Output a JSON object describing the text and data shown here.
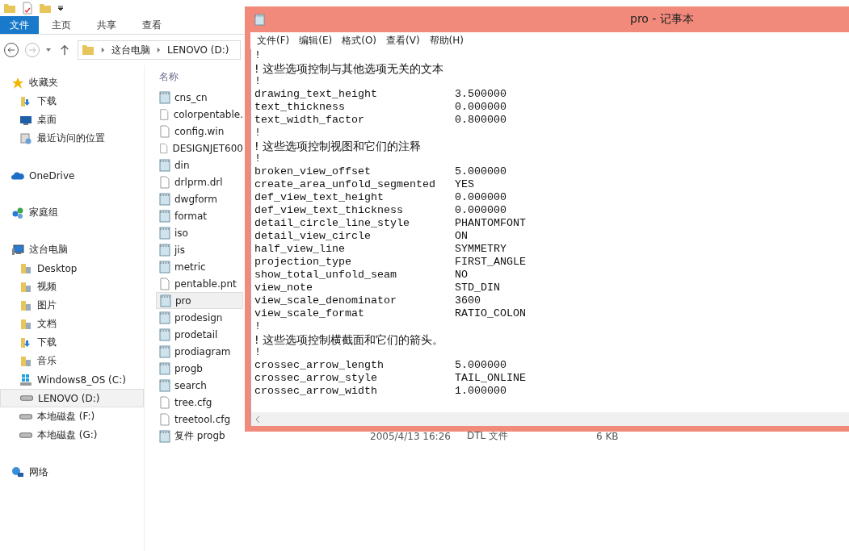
{
  "explorer": {
    "ribbon_tabs": [
      {
        "label": "文件",
        "selected": true
      },
      {
        "label": "主页",
        "selected": false
      },
      {
        "label": "共享",
        "selected": false
      },
      {
        "label": "查看",
        "selected": false
      }
    ],
    "address": {
      "crumbs": [
        "这台电脑",
        "LENOVO (D:)"
      ]
    },
    "nav": [
      {
        "label": "收藏夹",
        "kind": "favorites",
        "selected": false,
        "children": [
          {
            "label": "下载",
            "kind": "downloads",
            "selected": false
          },
          {
            "label": "桌面",
            "kind": "desktop",
            "selected": false
          },
          {
            "label": "最近访问的位置",
            "kind": "recent",
            "selected": false
          }
        ]
      },
      {
        "label": "OneDrive",
        "kind": "onedrive",
        "selected": false
      },
      {
        "label": "家庭组",
        "kind": "homegroup",
        "selected": false
      },
      {
        "label": "这台电脑",
        "kind": "pc",
        "selected": false,
        "children": [
          {
            "label": "Desktop",
            "kind": "folder",
            "selected": false
          },
          {
            "label": "视频",
            "kind": "folder",
            "selected": false
          },
          {
            "label": "图片",
            "kind": "folder",
            "selected": false
          },
          {
            "label": "文档",
            "kind": "folder",
            "selected": false
          },
          {
            "label": "下载",
            "kind": "downloads",
            "selected": false
          },
          {
            "label": "音乐",
            "kind": "folder",
            "selected": false
          },
          {
            "label": "Windows8_OS (C:)",
            "kind": "system-drive",
            "selected": false
          },
          {
            "label": "LENOVO (D:)",
            "kind": "drive",
            "selected": true
          },
          {
            "label": "本地磁盘 (F:)",
            "kind": "drive",
            "selected": false
          },
          {
            "label": "本地磁盘 (G:)",
            "kind": "drive",
            "selected": false
          }
        ]
      },
      {
        "label": "网络",
        "kind": "network",
        "selected": false
      }
    ],
    "name_header": "名称",
    "files": [
      {
        "name": "cns_cn",
        "kind": "document",
        "selected": false
      },
      {
        "name": "colorpentable.",
        "kind": "blank",
        "selected": false
      },
      {
        "name": "config.win",
        "kind": "blank",
        "selected": false
      },
      {
        "name": "DESIGNJET600",
        "kind": "blank",
        "selected": false
      },
      {
        "name": "din",
        "kind": "document",
        "selected": false
      },
      {
        "name": "drlprm.drl",
        "kind": "blank",
        "selected": false
      },
      {
        "name": "dwgform",
        "kind": "document",
        "selected": false
      },
      {
        "name": "format",
        "kind": "document",
        "selected": false
      },
      {
        "name": "iso",
        "kind": "document",
        "selected": false
      },
      {
        "name": "jis",
        "kind": "document",
        "selected": false
      },
      {
        "name": "metric",
        "kind": "document",
        "selected": false
      },
      {
        "name": "pentable.pnt",
        "kind": "blank",
        "selected": false
      },
      {
        "name": "pro",
        "kind": "document",
        "selected": true
      },
      {
        "name": "prodesign",
        "kind": "document",
        "selected": false
      },
      {
        "name": "prodetail",
        "kind": "document",
        "selected": false
      },
      {
        "name": "prodiagram",
        "kind": "document",
        "selected": false
      },
      {
        "name": "progb",
        "kind": "document",
        "selected": false
      },
      {
        "name": "search",
        "kind": "document",
        "selected": false
      },
      {
        "name": "tree.cfg",
        "kind": "blank",
        "selected": false
      },
      {
        "name": "treetool.cfg",
        "kind": "blank",
        "selected": false
      },
      {
        "name": "复件 progb",
        "kind": "document",
        "selected": false,
        "date": "2005/4/13 16:26",
        "type": "DTL 文件",
        "size": "6 KB"
      }
    ]
  },
  "notepad": {
    "title": "pro - 记事本",
    "menu": [
      "文件(F)",
      "编辑(E)",
      "格式(O)",
      "查看(V)",
      "帮助(H)"
    ],
    "lines": [
      {
        "kind": "bang",
        "text": "!"
      },
      {
        "kind": "comment",
        "text": "! 这些选项控制与其他选项无关的文本"
      },
      {
        "kind": "bang",
        "text": "!"
      },
      {
        "kind": "setting",
        "name": "drawing_text_height",
        "value": "3.500000"
      },
      {
        "kind": "setting",
        "name": "text_thickness",
        "value": "0.000000"
      },
      {
        "kind": "setting",
        "name": "text_width_factor",
        "value": "0.800000"
      },
      {
        "kind": "bang",
        "text": "!"
      },
      {
        "kind": "comment",
        "text": "! 这些选项控制视图和它们的注释"
      },
      {
        "kind": "bang",
        "text": "!"
      },
      {
        "kind": "setting",
        "name": "broken_view_offset",
        "value": "5.000000"
      },
      {
        "kind": "setting",
        "name": "create_area_unfold_segmented",
        "value": "YES"
      },
      {
        "kind": "setting",
        "name": "def_view_text_height",
        "value": "0.000000"
      },
      {
        "kind": "setting",
        "name": "def_view_text_thickness",
        "value": "0.000000"
      },
      {
        "kind": "setting",
        "name": "detail_circle_line_style",
        "value": "PHANTOMFONT"
      },
      {
        "kind": "setting",
        "name": "detail_view_circle",
        "value": "ON"
      },
      {
        "kind": "setting",
        "name": "half_view_line",
        "value": "SYMMETRY"
      },
      {
        "kind": "setting",
        "name": "projection_type",
        "value": "FIRST_ANGLE"
      },
      {
        "kind": "setting",
        "name": "show_total_unfold_seam",
        "value": "NO"
      },
      {
        "kind": "setting",
        "name": "view_note",
        "value": "STD_DIN"
      },
      {
        "kind": "setting",
        "name": "view_scale_denominator",
        "value": "3600"
      },
      {
        "kind": "setting",
        "name": "view_scale_format",
        "value": "RATIO_COLON"
      },
      {
        "kind": "bang",
        "text": "!"
      },
      {
        "kind": "comment",
        "text": "! 这些选项控制横截面和它们的箭头。"
      },
      {
        "kind": "bang",
        "text": "!"
      },
      {
        "kind": "setting",
        "name": "crossec_arrow_length",
        "value": "5.000000"
      },
      {
        "kind": "setting",
        "name": "crossec_arrow_style",
        "value": "TAIL_ONLINE"
      },
      {
        "kind": "setting",
        "name": "crossec_arrow_width",
        "value": "1.000000"
      }
    ]
  }
}
